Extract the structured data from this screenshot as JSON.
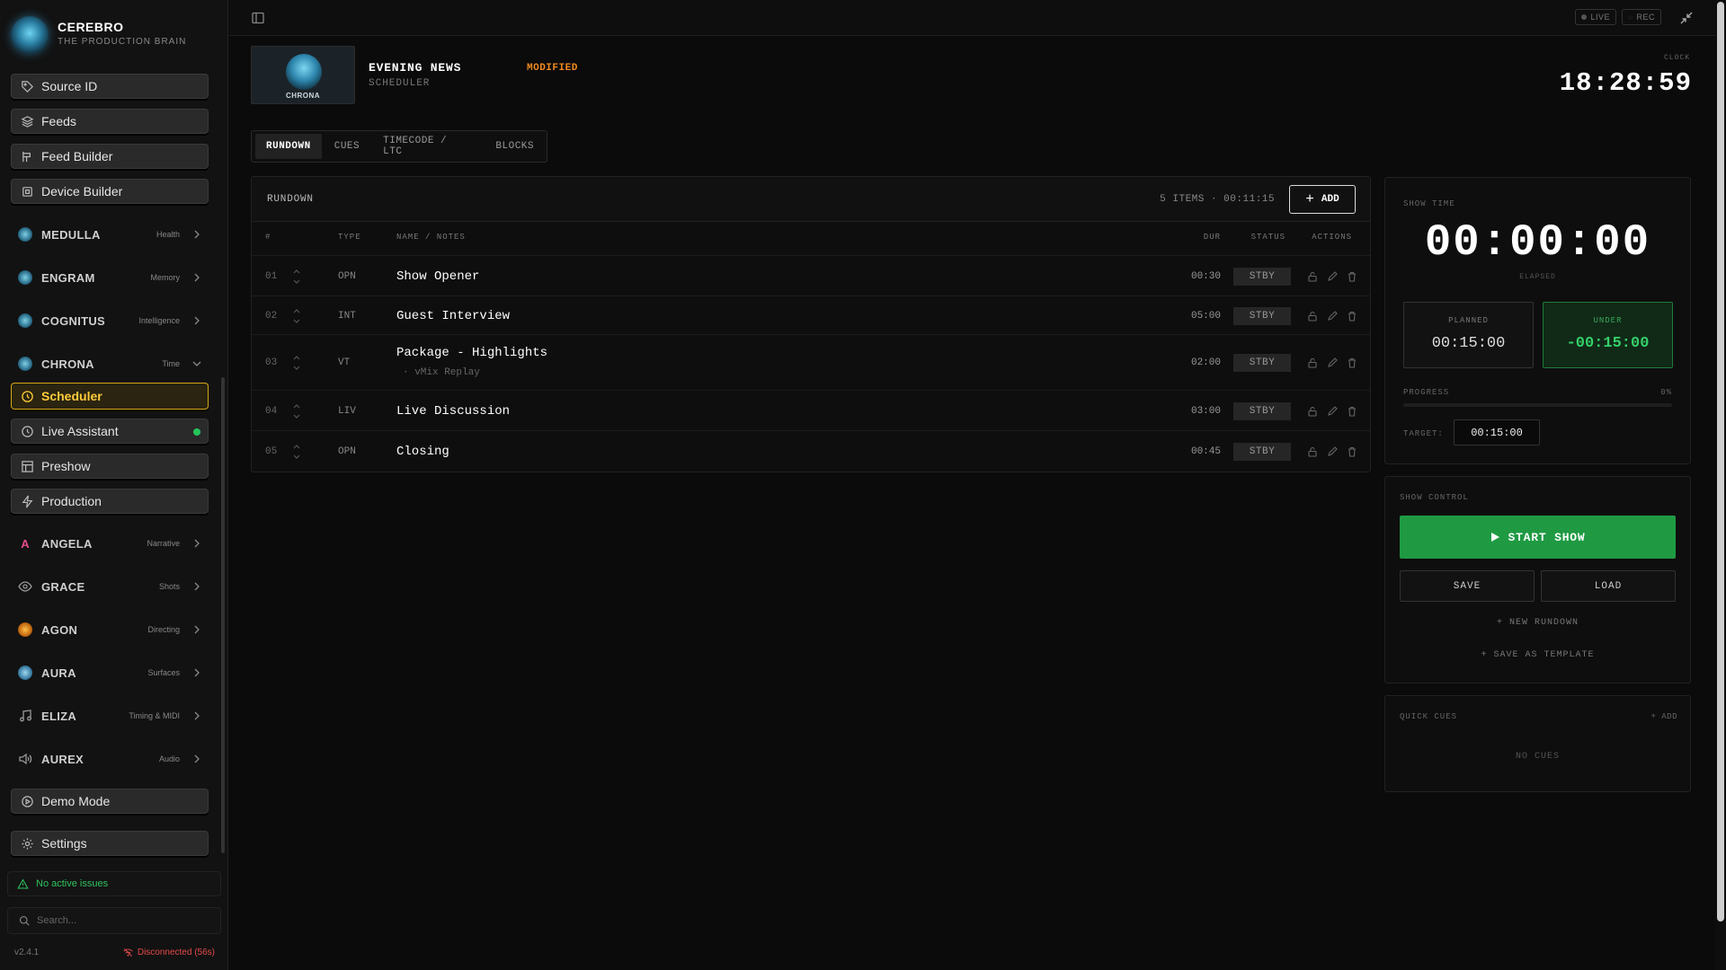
{
  "sidebar": {
    "brand": {
      "name": "CEREBRO",
      "tagline": "THE PRODUCTION BRAIN"
    },
    "top_buttons": [
      {
        "label": "Source ID",
        "icon": "tag-icon"
      },
      {
        "label": "Feeds",
        "icon": "layers-icon"
      },
      {
        "label": "Feed Builder",
        "icon": "builder-icon"
      },
      {
        "label": "Device Builder",
        "icon": "chip-icon"
      }
    ],
    "modules": [
      {
        "name": "MEDULLA",
        "tag": "Health"
      },
      {
        "name": "ENGRAM",
        "tag": "Memory"
      },
      {
        "name": "COGNITUS",
        "tag": "Intelligence"
      },
      {
        "name": "CHRONA",
        "tag": "Time"
      }
    ],
    "chrona_items": [
      {
        "label": "Scheduler",
        "icon": "clock-icon",
        "active": true
      },
      {
        "label": "Live Assistant",
        "icon": "clock-icon",
        "live": true
      },
      {
        "label": "Preshow",
        "icon": "grid-icon"
      },
      {
        "label": "Production",
        "icon": "bolt-icon"
      }
    ],
    "modules2": [
      {
        "name": "ANGELA",
        "tag": "Narrative"
      },
      {
        "name": "GRACE",
        "tag": "Shots"
      },
      {
        "name": "AGON",
        "tag": "Directing"
      },
      {
        "name": "AURA",
        "tag": "Surfaces"
      },
      {
        "name": "ELIZA",
        "tag": "Timing & MIDI"
      },
      {
        "name": "AUREX",
        "tag": "Audio"
      }
    ],
    "demo_mode": "Demo Mode",
    "settings": "Settings",
    "issues": "No active issues",
    "search_placeholder": "Search...",
    "version": "v2.4.1",
    "connection": "Disconnected (56s)"
  },
  "topbar": {
    "live": "LIVE",
    "rec": "REC"
  },
  "header": {
    "logo_label": "CHRONA",
    "title": "EVENING NEWS",
    "subtitle": "SCHEDULER",
    "state": "MODIFIED",
    "clock_label": "CLOCK",
    "clock": "18:28:59"
  },
  "tabs": [
    "RUNDOWN",
    "CUES",
    "TIMECODE / LTC",
    "BLOCKS"
  ],
  "rundown": {
    "title": "RUNDOWN",
    "count": "5 ITEMS · 00:11:15",
    "add": "ADD",
    "columns": {
      "num": "#",
      "type": "TYPE",
      "name": "NAME / NOTES",
      "dur": "DUR",
      "status": "STATUS",
      "actions": "ACTIONS"
    },
    "rows": [
      {
        "num": "01",
        "type": "OPN",
        "name": "Show Opener",
        "note": "",
        "dur": "00:30",
        "status": "STBY"
      },
      {
        "num": "02",
        "type": "INT",
        "name": "Guest Interview",
        "note": "",
        "dur": "05:00",
        "status": "STBY"
      },
      {
        "num": "03",
        "type": "VT",
        "name": "Package - Highlights",
        "note": "· vMix Replay",
        "dur": "02:00",
        "status": "STBY"
      },
      {
        "num": "04",
        "type": "LIV",
        "name": "Live Discussion",
        "note": "",
        "dur": "03:00",
        "status": "STBY"
      },
      {
        "num": "05",
        "type": "OPN",
        "name": "Closing",
        "note": "",
        "dur": "00:45",
        "status": "STBY"
      }
    ]
  },
  "showtime": {
    "label": "SHOW TIME",
    "value": "00:00:00",
    "elapsed": "ELAPSED",
    "planned_label": "PLANNED",
    "planned": "00:15:00",
    "under_label": "UNDER",
    "under": "-00:15:00",
    "progress_label": "PROGRESS",
    "progress_text": "0%",
    "progress": 0,
    "target_label": "TARGET:",
    "target": "00:15:00"
  },
  "control": {
    "label": "SHOW CONTROL",
    "start": "START SHOW",
    "save": "SAVE",
    "load": "LOAD",
    "new_rundown": "+ NEW RUNDOWN",
    "save_template": "+ SAVE AS TEMPLATE"
  },
  "quick_cues": {
    "label": "QUICK CUES",
    "add": "+ ADD",
    "empty": "NO CUES"
  },
  "colors": {
    "accent": "#d6a71a",
    "go": "#1f9a43",
    "under": "#36d06a",
    "modified": "#f08a1f",
    "error": "#e64a4a"
  }
}
